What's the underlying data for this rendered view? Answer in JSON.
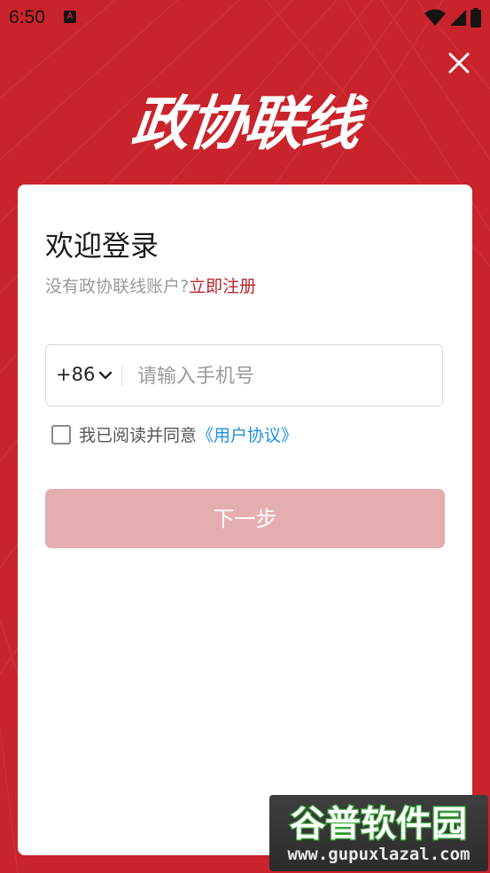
{
  "status": {
    "time": "6:50",
    "notify_glyph": "A"
  },
  "app": {
    "logo_text": "政协联线"
  },
  "login": {
    "title": "欢迎登录",
    "no_account_prefix": "没有政协联线账户?",
    "register_link": "立即注册",
    "country_code": "+86",
    "phone_placeholder": "请输入手机号",
    "phone_value": "",
    "agree_text": "我已阅读并同意",
    "agreement_link": "《用户协议》",
    "agreed": false,
    "next_button": "下一步"
  },
  "watermark": {
    "logo_text": "谷普软件园",
    "url": "www.gupuxlazal.com"
  },
  "colors": {
    "background": "#c9232b",
    "accent_red": "#b7242c",
    "button_disabled": "#e4aeb0",
    "link_blue": "#1f8fe0"
  },
  "icons": [
    "close-icon",
    "chevron-down-icon",
    "wifi-icon",
    "signal-icon",
    "battery-icon",
    "checkbox-icon"
  ]
}
